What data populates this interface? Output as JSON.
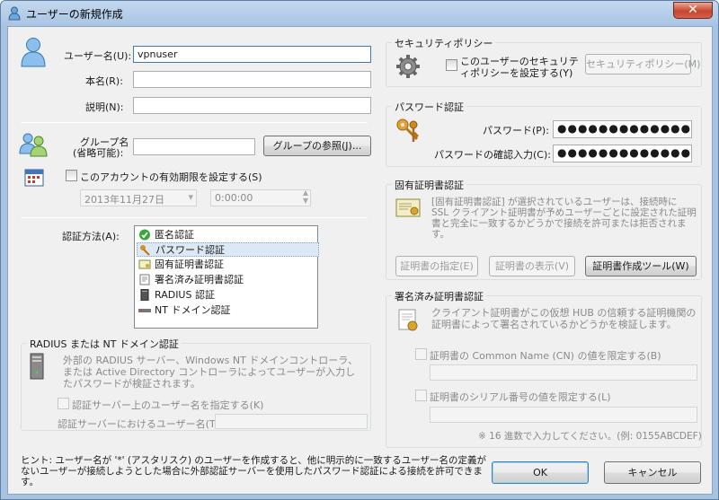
{
  "window": {
    "title": "ユーザーの新規作成",
    "close": "✕"
  },
  "user": {
    "name_label": "ユーザー名(U):",
    "name_value": "vpnuser",
    "realname_label": "本名(R):",
    "realname_value": "",
    "note_label": "説明(N):",
    "note_value": ""
  },
  "group": {
    "label1": "グループ名",
    "label2": "(省略可能):",
    "value": "",
    "browse_button": "グループの参照(J)..."
  },
  "expire": {
    "checkbox_label": "このアカウントの有効期限を設定する(S)",
    "date": "2013年11月27日",
    "time": "0:00:00"
  },
  "auth": {
    "label": "認証方法(A):",
    "items": [
      {
        "label": "匿名認証"
      },
      {
        "label": "パスワード認証"
      },
      {
        "label": "固有証明書認証"
      },
      {
        "label": "署名済み証明書認証"
      },
      {
        "label": "RADIUS 認証"
      },
      {
        "label": "NT ドメイン認証"
      }
    ],
    "selected_index": 1
  },
  "radius": {
    "group_title": "RADIUS または NT ドメイン認証",
    "description": "外部の RADIUS サーバー、Windows NT ドメインコントローラ、または Active Directory コントローラによってユーザーが入力したパスワードが検証されます。",
    "checkbox_label": "認証サーバー上のユーザー名を指定する(K)",
    "username_label": "認証サーバーにおけるユーザー名(T):",
    "username_value": ""
  },
  "hint": {
    "text": "ヒント: ユーザー名が '*' (アスタリスク) のユーザーを作成すると、他に明示的に一致するユーザー名の定義がないユーザーが接続しようとした場合に外部認証サーバーを使用したパスワード認証による接続を許可できます。"
  },
  "security": {
    "group_title": "セキュリティポリシー",
    "checkbox_label": "このユーザーのセキュリティポリシーを設定する(Y)",
    "button": "セキュリティポリシー(M)"
  },
  "password": {
    "group_title": "パスワード認証",
    "password_label": "パスワード(P):",
    "password_value": "●●●●●●●●●●●●●●",
    "confirm_label": "パスワードの確認入力(C):",
    "confirm_value": "●●●●●●●●●●●●●●"
  },
  "cert": {
    "group_title": "固有証明書認証",
    "description": "[固有証明書認証] が選択されているユーザーは、接続時に SSL クライアント証明書が予めユーザーごとに設定された証明書と完全に一致するかどうかで接続を許可または拒否されます。",
    "specify_button": "証明書の指定(E)",
    "show_button": "証明書の表示(V)",
    "tool_button": "証明書作成ツール(W)"
  },
  "signed": {
    "group_title": "署名済み証明書認証",
    "description": "クライアント証明書がこの仮想 HUB の信頼する証明機関の証明書によって署名されているかどうかを検証します。",
    "cn_checkbox": "証明書の Common Name (CN) の値を限定する(B)",
    "cn_value": "",
    "serial_checkbox": "証明書のシリアル番号の値を限定する(L)",
    "serial_value": "",
    "note": "※ 16 進数で入力してください。(例: 0155ABCDEF)"
  },
  "footer": {
    "ok": "OK",
    "cancel": "キャンセル"
  }
}
